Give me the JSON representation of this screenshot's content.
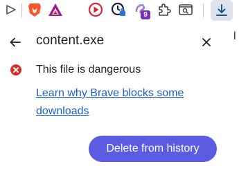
{
  "toolbar": {
    "extensions_badge": "9",
    "icons": [
      "cast-icon",
      "brave-shields-icon",
      "brave-rewards-icon",
      "media-icon",
      "vpn-icon",
      "extension-icon",
      "puzzle-icon",
      "reader-icon",
      "download-icon"
    ],
    "overflow_text": "l"
  },
  "panel": {
    "title": "content.exe",
    "message": "This file is dangerous",
    "link": "Learn why Brave blocks some downloads",
    "delete_button": "Delete from history"
  },
  "colors": {
    "accent": "#5b5ce2",
    "link": "#1a5fd0",
    "danger": "#d93025"
  }
}
